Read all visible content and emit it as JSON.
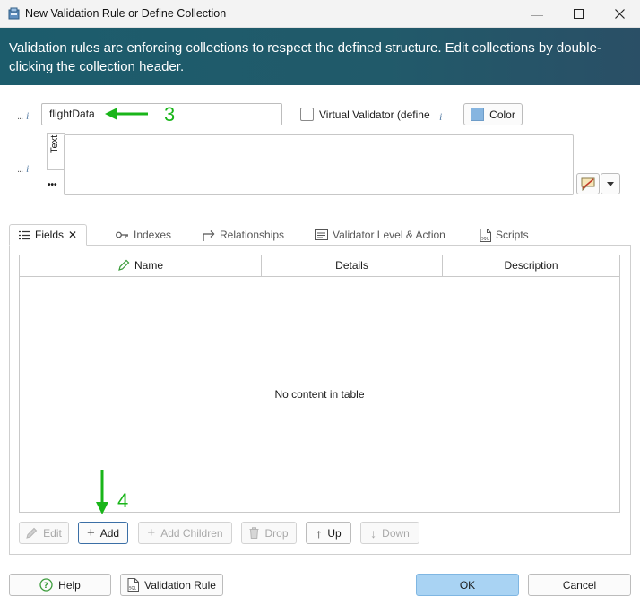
{
  "window": {
    "title": "New Validation Rule or Define Collection",
    "minimize_glyph": "—",
    "maximize_glyph": "☐",
    "close_glyph": "✕"
  },
  "banner": {
    "text": "Validation rules are enforcing collections to respect the defined structure. Edit collections by double-clicking the collection header."
  },
  "name_row": {
    "name_value": "flightData",
    "virtual_validator_label": "Virtual Validator (define",
    "color_button_label": "Color",
    "color_swatch": "#86b5e0"
  },
  "comment": {
    "side_tab_label": "Text",
    "ellipsis_label": "•••",
    "value": ""
  },
  "tabs": [
    {
      "label": "Fields",
      "icon": "list-icon",
      "active": true
    },
    {
      "label": "Indexes",
      "icon": "key-icon"
    },
    {
      "label": "Relationships",
      "icon": "relationship-arrow-icon"
    },
    {
      "label": "Validator Level & Action",
      "icon": "validator-icon"
    },
    {
      "label": "Scripts",
      "icon": "sql-script-icon"
    }
  ],
  "table": {
    "columns": [
      "Name",
      "Details",
      "Description"
    ],
    "empty_message": "No content in table"
  },
  "toolbar": {
    "edit_label": "Edit",
    "add_label": "Add",
    "add_children_label": "Add Children",
    "drop_label": "Drop",
    "up_label": "Up",
    "down_label": "Down"
  },
  "footer": {
    "help_label": "Help",
    "validation_rule_label": "Validation Rule",
    "ok_label": "OK",
    "cancel_label": "Cancel"
  },
  "annotations": {
    "step_3": "3",
    "step_4": "4",
    "color": "#19b519"
  },
  "colors": {
    "banner": "#1f5b6b",
    "primary_button": "#a9d3f3"
  }
}
